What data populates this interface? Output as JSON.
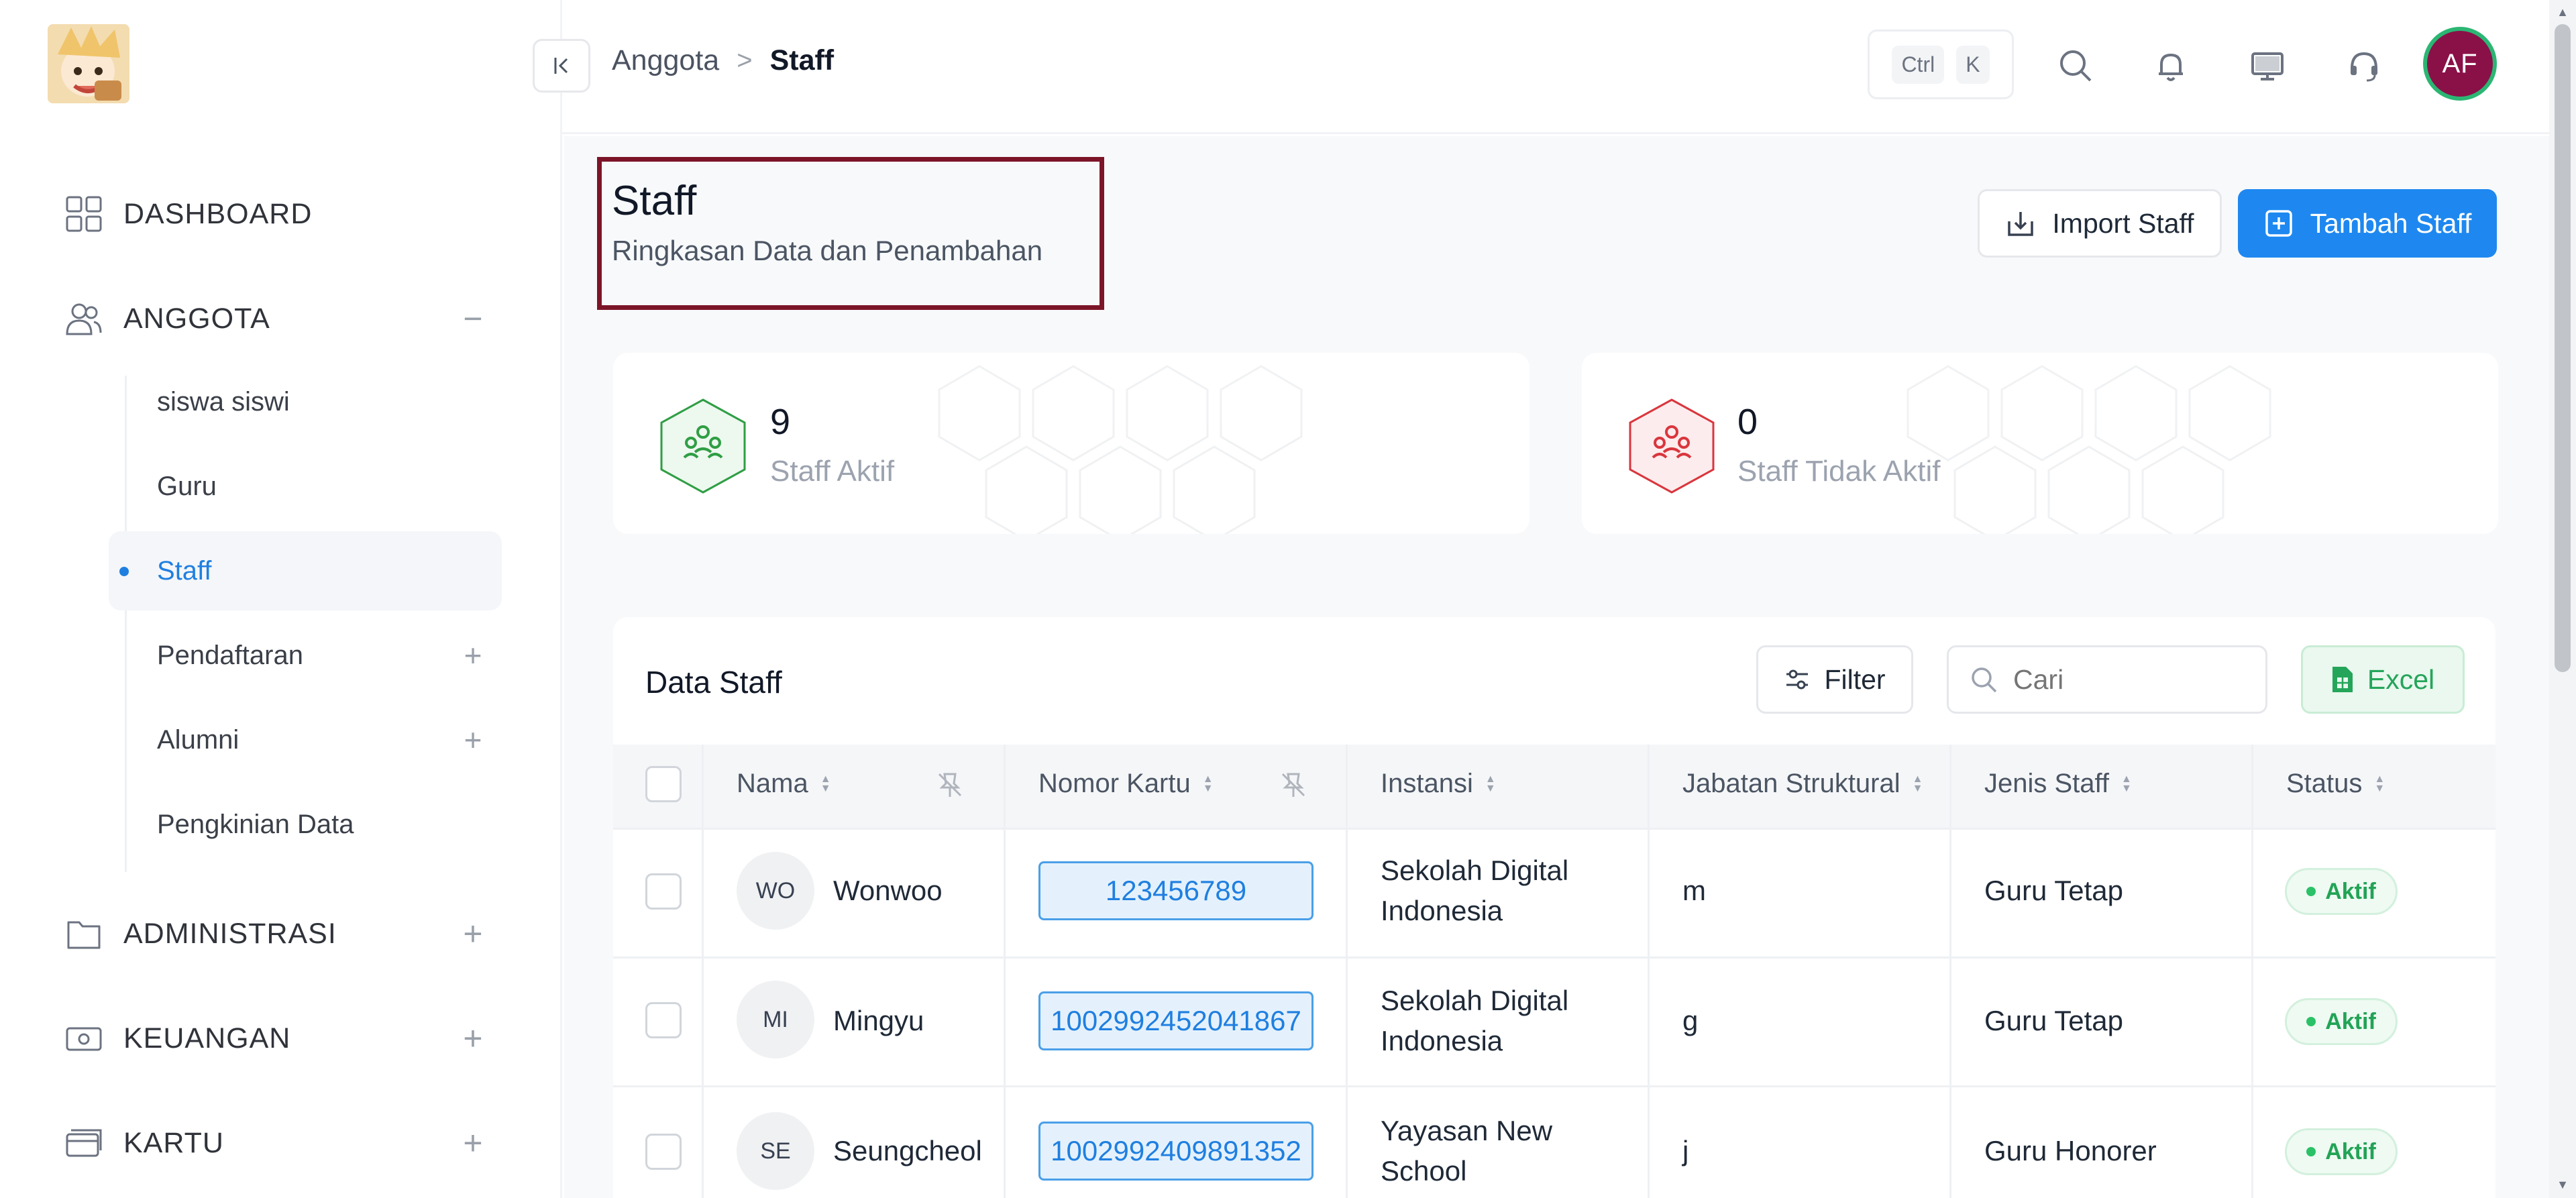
{
  "sidebar": {
    "groups": [
      {
        "label": "DASHBOARD",
        "toggle": ""
      },
      {
        "label": "ANGGOTA",
        "toggle": "−"
      },
      {
        "label": "ADMINISTRASI",
        "toggle": "+"
      },
      {
        "label": "KEUANGAN",
        "toggle": "+"
      },
      {
        "label": "KARTU",
        "toggle": "+"
      }
    ],
    "anggota_items": [
      {
        "label": "siswa siswi"
      },
      {
        "label": "Guru"
      },
      {
        "label": "Staff",
        "active": true
      },
      {
        "label": "Pendaftaran",
        "toggle": "+"
      },
      {
        "label": "Alumni",
        "toggle": "+"
      },
      {
        "label": "Pengkinian Data"
      }
    ]
  },
  "topbar": {
    "breadcrumb": [
      "Anggota",
      "Staff"
    ],
    "breadcrumb_sep": ">",
    "shortcut_keys": [
      "Ctrl",
      "K"
    ],
    "avatar_initials": "AF",
    "icons": [
      "search-icon",
      "bell-icon",
      "monitor-icon",
      "headset-icon"
    ]
  },
  "page": {
    "title": "Staff",
    "subtitle": "Ringkasan Data dan Penambahan",
    "import_label": "Import Staff",
    "add_label": "Tambah Staff"
  },
  "stats": [
    {
      "value": "9",
      "label": "Staff Aktif",
      "color": "#2f9e44"
    },
    {
      "value": "0",
      "label": "Staff Tidak Aktif",
      "color": "#d9363e"
    }
  ],
  "table": {
    "title": "Data Staff",
    "filter_label": "Filter",
    "search_placeholder": "Cari",
    "excel_label": "Excel",
    "columns": [
      "Nama",
      "Nomor Kartu",
      "Instansi",
      "Jabatan Struktural",
      "Jenis Staff",
      "Status"
    ],
    "rows": [
      {
        "initials": "WO",
        "name": "Wonwoo",
        "card": "123456789",
        "instansi_1": "Sekolah Digital",
        "instansi_2": "Indonesia",
        "jabatan": "m",
        "jenis": "Guru Tetap",
        "status": "Aktif"
      },
      {
        "initials": "MI",
        "name": "Mingyu",
        "card": "1002992452041867",
        "instansi_1": "Sekolah Digital",
        "instansi_2": "Indonesia",
        "jabatan": "g",
        "jenis": "Guru Tetap",
        "status": "Aktif"
      },
      {
        "initials": "SE",
        "name": "Seungcheol",
        "card": "1002992409891352",
        "instansi_1": "Yayasan New",
        "instansi_2": "School",
        "jabatan": "j",
        "jenis": "Guru Honorer",
        "status": "Aktif"
      }
    ]
  },
  "colors": {
    "primary": "#1e88f0",
    "active_text": "#1f7fe0",
    "highlight_box": "#7c1528",
    "success": "#22a356",
    "avatar_bg": "#8a1048"
  }
}
